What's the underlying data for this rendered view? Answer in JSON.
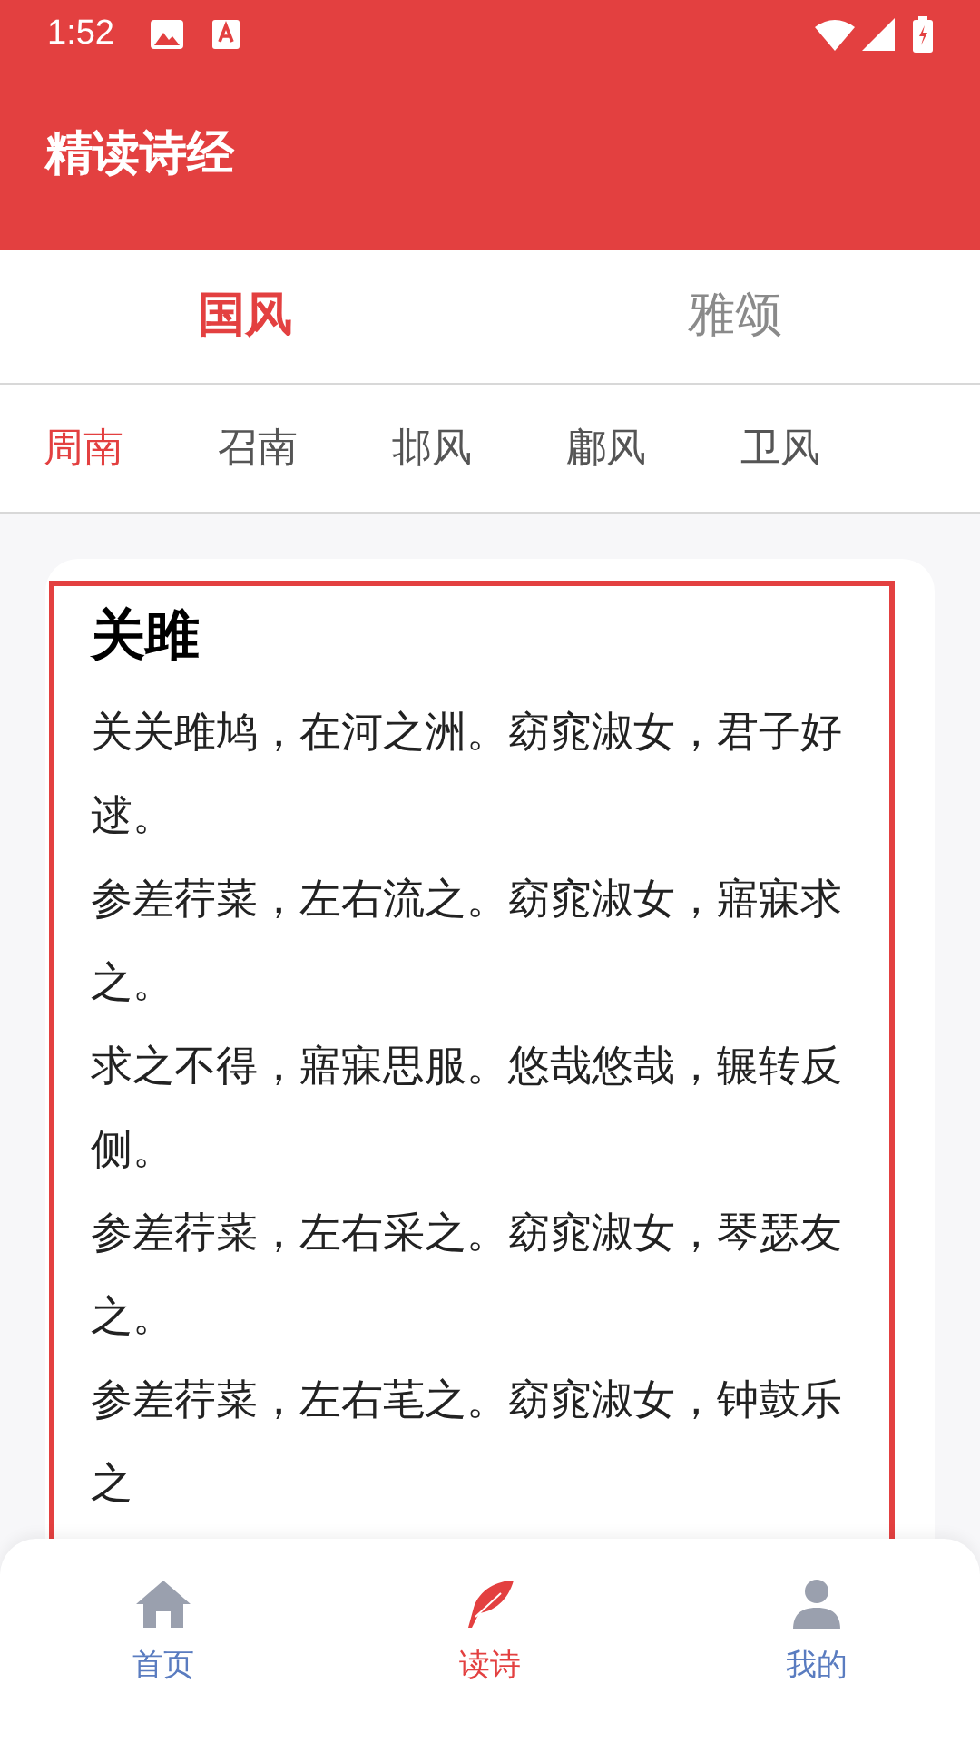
{
  "status_bar": {
    "time": "1:52"
  },
  "app_bar": {
    "title": "精读诗经"
  },
  "tabs": [
    {
      "label": "国风",
      "selected": true
    },
    {
      "label": "雅颂",
      "selected": false
    }
  ],
  "sub_tabs": [
    {
      "label": "周南",
      "selected": true
    },
    {
      "label": "召南",
      "selected": false
    },
    {
      "label": "邶风",
      "selected": false
    },
    {
      "label": "鄘风",
      "selected": false
    },
    {
      "label": "卫风",
      "selected": false
    }
  ],
  "poem": {
    "title": "关雎",
    "lines": [
      "关关雎鸠，在河之洲。窈窕淑女，君子好逑。",
      "参差荇菜，左右流之。窈窕淑女，寤寐求之。",
      "求之不得，寤寐思服。悠哉悠哉，辗转反侧。",
      "参差荇菜，左右采之。窈窕淑女，琴瑟友之。",
      "参差荇菜，左右芼之。窈窕淑女，钟鼓乐之"
    ]
  },
  "bottom_nav": [
    {
      "kind": "home",
      "label": "首页",
      "selected": false
    },
    {
      "kind": "feather",
      "label": "读诗",
      "selected": true
    },
    {
      "kind": "user",
      "label": "我的",
      "selected": false
    }
  ]
}
